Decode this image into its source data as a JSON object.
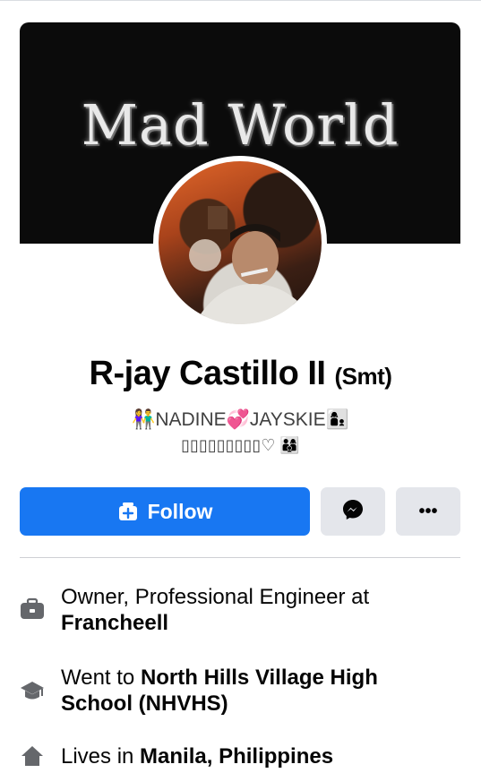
{
  "cover": {
    "text": "Mad World"
  },
  "profile": {
    "name": "R-jay Castillo II",
    "name_suffix": "(Smt)",
    "bio_line1": "👫NADINE💞JAYSKIE👩‍👦",
    "bio_line2": "▯▯▯▯▯▯▯▯▯♡ 👨‍👩‍👦"
  },
  "actions": {
    "follow_label": "Follow",
    "more_label": "•••"
  },
  "info": {
    "work_prefix": "Owner, Professional Engineer at",
    "work_place": "Francheell",
    "school_prefix": "Went to",
    "school_name": "North Hills Village High School (NHVHS)",
    "lives_prefix": "Lives in",
    "lives_place": "Manila, Philippines"
  },
  "colors": {
    "accent": "#1877f2",
    "button_secondary": "#e4e6eb",
    "text_primary": "#050505",
    "icon_gray": "#65676b"
  },
  "icons": [
    "messenger-icon",
    "more-icon",
    "follow-icon",
    "work-icon",
    "school-icon",
    "home-icon"
  ]
}
